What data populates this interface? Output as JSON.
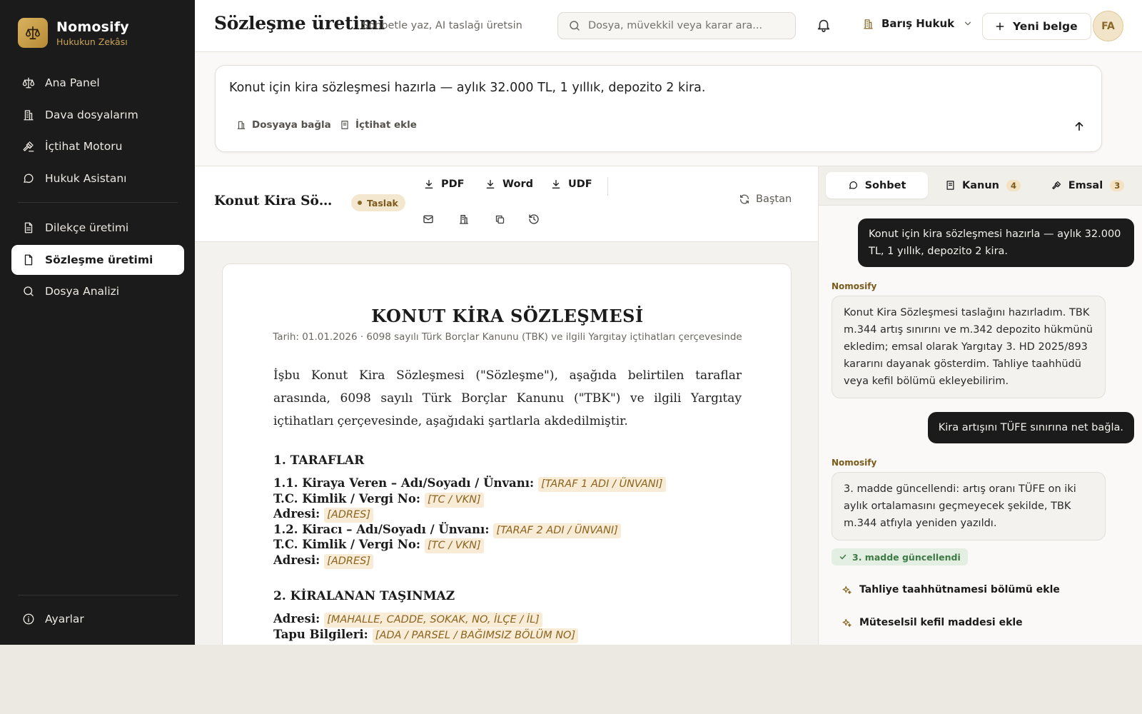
{
  "colors": {
    "accent": "#c9a457",
    "sidebar_bg": "#1b1b1c",
    "draft_badge_bg": "#f4e7cf",
    "placeholder_bg": "#f8ecd6",
    "success": "#3d7a45"
  },
  "brand": {
    "name": "Nomosify",
    "tagline": "Hukukun Zekâsı",
    "icon": "scales-icon"
  },
  "sidebar": {
    "items": [
      {
        "label": "Ana Panel",
        "icon": "scales-icon"
      },
      {
        "label": "Dava dosyalarım",
        "icon": "building-icon"
      },
      {
        "label": "İçtihat Motoru",
        "icon": "gavel-icon"
      },
      {
        "label": "Hukuk Asistanı",
        "icon": "chat-icon"
      },
      {
        "label": "Dilekçe üretimi",
        "icon": "document-icon"
      },
      {
        "label": "Sözleşme üretimi",
        "icon": "file-icon",
        "active": true
      },
      {
        "label": "Dosya Analizi",
        "icon": "search-icon"
      }
    ],
    "settings": {
      "label": "Ayarlar",
      "icon": "info-icon"
    }
  },
  "header": {
    "title": "Sözleşme üretimi",
    "subtitle": "Sohbetle yaz, AI taslağı üretsin",
    "search_placeholder": "Dosya, müvekkil veya karar ara...",
    "org": "Barış Hukuk",
    "new_doc": "Yeni belge",
    "avatar": "FA"
  },
  "prompt": {
    "text": "Konut için kira sözleşmesi hazırla — aylık 32.000 TL, 1 yıllık, depozito 2 kira.",
    "attach_file": "Dosyaya bağla",
    "add_case": "İçtihat ekle"
  },
  "doc_toolbar": {
    "title": "Konut Kira Sözleşmesi",
    "status": "Taslak",
    "downloads": [
      "PDF",
      "Word",
      "UDF"
    ],
    "icons": [
      "mail-icon",
      "building-icon",
      "copy-icon",
      "history-icon"
    ],
    "reset": "Baştan"
  },
  "document": {
    "heading": "KONUT KİRA SÖZLEŞMESİ",
    "meta": "Tarih: 01.01.2026 · 6098 sayılı Türk Borçlar Kanunu (TBK) ve ilgili Yargıtay içtihatları çerçevesinde",
    "intro": "İşbu Konut Kira Sözleşmesi (\"Sözleşme\"), aşağıda belirtilen taraflar arasında, 6098 sayılı Türk Borçlar Kanunu (\"TBK\") ve ilgili Yargıtay içtihatları çerçevesinde, aşağıdaki şartlarla akdedilmiştir.",
    "sections": [
      {
        "title": "1. TARAFLAR",
        "fields": [
          {
            "label": "1.1. Kiraya Veren – Adı/Soyadı / Ünvanı:",
            "value": "[TARAF 1 ADI / ÜNVANI]"
          },
          {
            "label": "T.C. Kimlik / Vergi No:",
            "value": "[TC / VKN]"
          },
          {
            "label": "Adresi:",
            "value": "[ADRES]"
          },
          {
            "label": "1.2. Kiracı – Adı/Soyadı / Ünvanı:",
            "value": "[TARAF 2 ADI / ÜNVANI]"
          },
          {
            "label": "T.C. Kimlik / Vergi No:",
            "value": "[TC / VKN]"
          },
          {
            "label": "Adresi:",
            "value": "[ADRES]"
          }
        ]
      },
      {
        "title": "2. KİRALANAN TAŞINMAZ",
        "fields": [
          {
            "label": "Adresi:",
            "value": "[MAHALLE, CADDE, SOKAK, NO, İLÇE / İL]"
          },
          {
            "label": "Tapu Bilgileri:",
            "value": "[ADA / PARSEL / BAĞIMSIZ BÖLÜM NO]"
          }
        ]
      }
    ]
  },
  "panel": {
    "tabs": [
      {
        "label": "Sohbet",
        "icon": "chat-icon",
        "active": true
      },
      {
        "label": "Kanun",
        "icon": "book-icon",
        "count": "4"
      },
      {
        "label": "Emsal",
        "icon": "gavel-icon",
        "count": "3"
      }
    ],
    "bot_name": "Nomosify",
    "messages": [
      {
        "role": "user",
        "text": "Konut için kira sözleşmesi hazırla — aylık 32.000 TL, 1 yıllık, depozito 2 kira."
      },
      {
        "role": "bot",
        "text": "Konut Kira Sözleşmesi taslağını hazırladım. TBK m.344 artış sınırını ve m.342 depozito hükmünü ekledim; emsal olarak Yargıtay 3. HD 2025/893 kararını dayanak gösterdim. Tahliye taahhüdü veya kefil bölümü ekleyebilirim."
      },
      {
        "role": "user",
        "text": "Kira artışını TÜFE sınırına net bağla."
      },
      {
        "role": "bot",
        "text": "3. madde güncellendi: artış oranı TÜFE on iki aylık ortalamasını geçmeyecek şekilde, TBK m.344 atfıyla yeniden yazıldı."
      }
    ],
    "status_pill": "3. madde güncellendi",
    "suggestions": [
      "Tahliye taahhütnamesi bölümü ekle",
      "Müteselsil kefil maddesi ekle"
    ]
  }
}
